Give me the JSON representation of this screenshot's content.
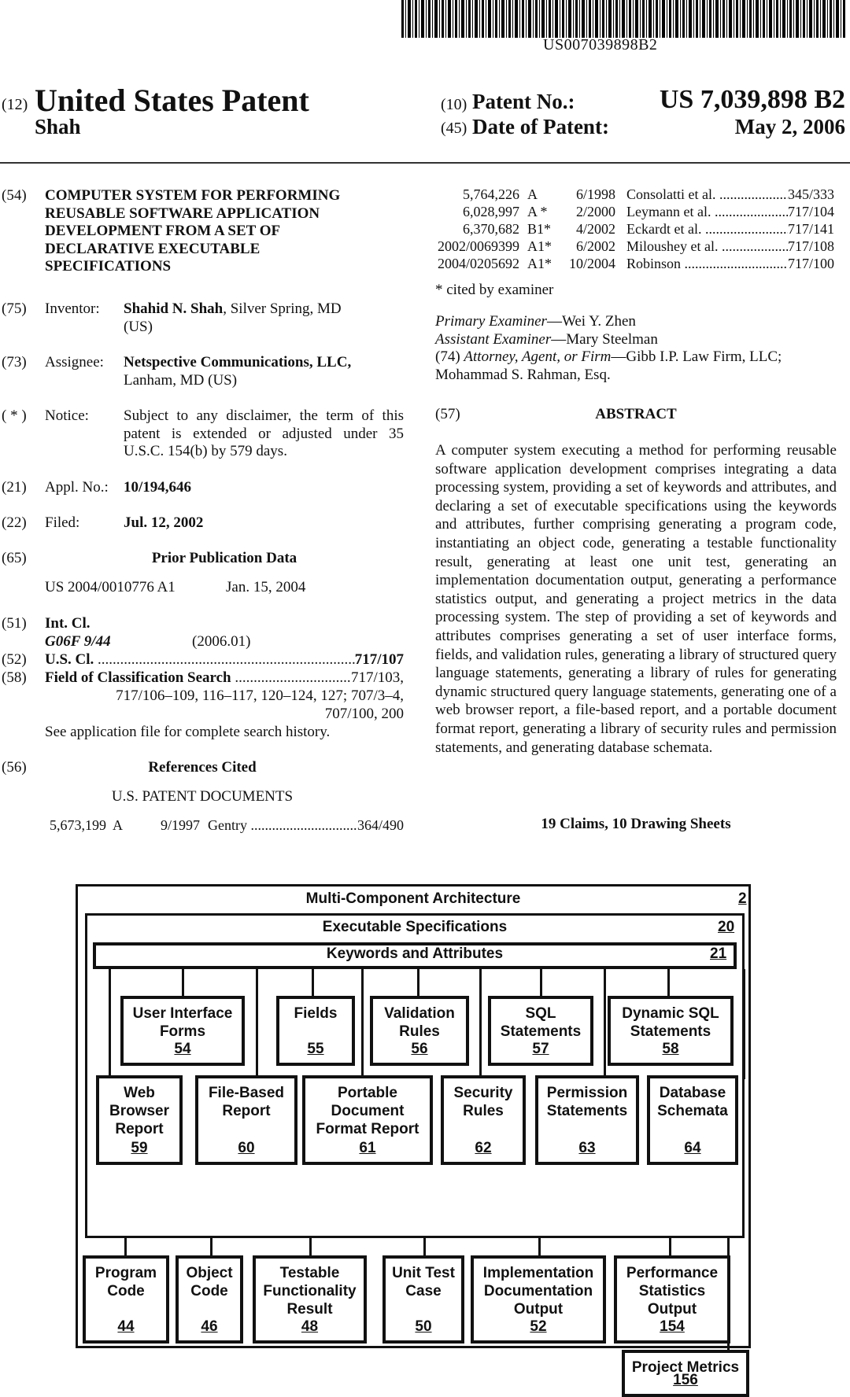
{
  "barcode": {
    "number": "US007039898B2"
  },
  "header": {
    "code_12": "(12)",
    "title": "United States Patent",
    "inventor_surname": "Shah",
    "code_10": "(10)",
    "patent_no_label": "Patent No.:",
    "patent_no": "US 7,039,898 B2",
    "code_45": "(45)",
    "date_label": "Date of Patent:",
    "date": "May 2, 2006"
  },
  "left": {
    "title_code": "(54)",
    "title_lines": [
      "COMPUTER SYSTEM FOR PERFORMING",
      "REUSABLE SOFTWARE APPLICATION",
      "DEVELOPMENT FROM A SET OF",
      "DECLARATIVE EXECUTABLE",
      "SPECIFICATIONS"
    ],
    "inventor": {
      "code": "(75)",
      "label": "Inventor:",
      "name": "Shahid N. Shah",
      "loc1": ", Silver Spring, MD",
      "loc2": "(US)"
    },
    "assignee": {
      "code": "(73)",
      "label": "Assignee:",
      "name": "Netspective Communications, LLC,",
      "loc": "Lanham, MD (US)"
    },
    "notice": {
      "code": "( * )",
      "label": "Notice:",
      "lines": [
        "Subject to any disclaimer, the term of this",
        "patent is extended or adjusted under 35",
        "U.S.C. 154(b) by 579 days."
      ]
    },
    "appl": {
      "code": "(21)",
      "label": "Appl. No.:",
      "value": "10/194,646"
    },
    "filed": {
      "code": "(22)",
      "label": "Filed:",
      "value": "Jul. 12, 2002"
    },
    "prior": {
      "code": "(65)",
      "heading": "Prior Publication Data",
      "pub": "US 2004/0010776 A1",
      "date": "Jan. 15, 2004"
    },
    "intcl": {
      "code": "(51)",
      "label": "Int. Cl.",
      "class": "G06F 9/44",
      "version": "(2006.01)"
    },
    "uscl": {
      "code": "(52)",
      "label": "U.S. Cl.",
      "value": "717/107"
    },
    "field": {
      "code": "(58)",
      "label": "Field of Classification Search",
      "value1": "717/103,",
      "line2": "717/106–109, 116–117, 120–124, 127;  707/3–4,",
      "line3": "707/100, 200",
      "note": "See application file for complete search history."
    },
    "refs": {
      "code": "(56)",
      "heading": "References Cited",
      "subheading": "U.S. PATENT DOCUMENTS"
    }
  },
  "references": [
    {
      "number": "5,673,199",
      "kind": "A",
      "date": "9/1997",
      "name": "Gentry",
      "class": "364/490"
    },
    {
      "number": "5,764,226",
      "kind": "A",
      "date": "6/1998",
      "name": "Consolatti et al.",
      "class": "345/333"
    },
    {
      "number": "6,028,997",
      "kind": "A *",
      "date": "2/2000",
      "name": "Leymann et al.",
      "class": "717/104"
    },
    {
      "number": "6,370,682",
      "kind": "B1*",
      "date": "4/2002",
      "name": "Eckardt et al.",
      "class": "717/141"
    },
    {
      "number": "2002/0069399",
      "kind": "A1*",
      "date": "6/2002",
      "name": "Miloushey et al.",
      "class": "717/108"
    },
    {
      "number": "2004/0205692",
      "kind": "A1*",
      "date": "10/2004",
      "name": "Robinson",
      "class": "717/100"
    }
  ],
  "right": {
    "cited_note": "* cited by examiner",
    "primary_label": "Primary Examiner",
    "primary": "—Wei Y. Zhen",
    "assistant_label": "Assistant Examiner",
    "assistant": "—Mary Steelman",
    "attorney_code": "(74) ",
    "attorney_label": "Attorney, Agent, or Firm",
    "attorney": "—Gibb I.P. Law Firm, LLC;",
    "attorney2": "Mohammad S. Rahman, Esq.",
    "abstract_code": "(57)",
    "abstract_heading": "ABSTRACT",
    "abstract": "A computer system executing a method for performing reusable software application development comprises integrating a data processing system, providing a set of keywords and attributes, and declaring a set of executable specifications using the keywords and attributes, further comprising generating a program code, instantiating an object code, generating a testable functionality result, generating at least one unit test, generating an implementation documentation output, generating a performance statistics output, and generating a project metrics in the data processing system. The step of providing a set of keywords and attributes comprises generating a set of user interface forms, fields, and validation rules, generating a library of structured query language statements, generating a library of rules for generating dynamic structured query language statements, generating one of a web browser report, a file-based report, and a portable document format report, generating a library of security rules and permission statements, and generating database schemata.",
    "claims": "19 Claims, 10 Drawing Sheets"
  },
  "diagram": {
    "outer": {
      "title": "Multi-Component Architecture",
      "num": "2"
    },
    "spec": {
      "title": "Executable Specifications",
      "num": "20"
    },
    "kw": {
      "title": "Keywords and Attributes",
      "num": "21"
    },
    "row1": [
      {
        "label": "User Interface Forms",
        "num": "54"
      },
      {
        "label": "Fields",
        "num": "55"
      },
      {
        "label": "Validation Rules",
        "num": "56"
      },
      {
        "label": "SQL Statements",
        "num": "57"
      },
      {
        "label": "Dynamic SQL Statements",
        "num": "58"
      }
    ],
    "row2": [
      {
        "label": "Web Browser Report",
        "num": "59"
      },
      {
        "label": "File-Based Report",
        "num": "60"
      },
      {
        "label": "Portable Document Format Report",
        "num": "61"
      },
      {
        "label": "Security Rules",
        "num": "62"
      },
      {
        "label": "Permission Statements",
        "num": "63"
      },
      {
        "label": "Database Schemata",
        "num": "64"
      }
    ],
    "row3": [
      {
        "label": "Program Code",
        "num": "44"
      },
      {
        "label": "Object Code",
        "num": "46"
      },
      {
        "label": "Testable Functionality Result",
        "num": "48"
      },
      {
        "label": "Unit Test Case",
        "num": "50"
      },
      {
        "label": "Implementation Documentation Output",
        "num": "52"
      },
      {
        "label": "Performance Statistics Output",
        "num": "154"
      }
    ],
    "metrics": {
      "label": "Project Metrics",
      "num": "156"
    }
  }
}
